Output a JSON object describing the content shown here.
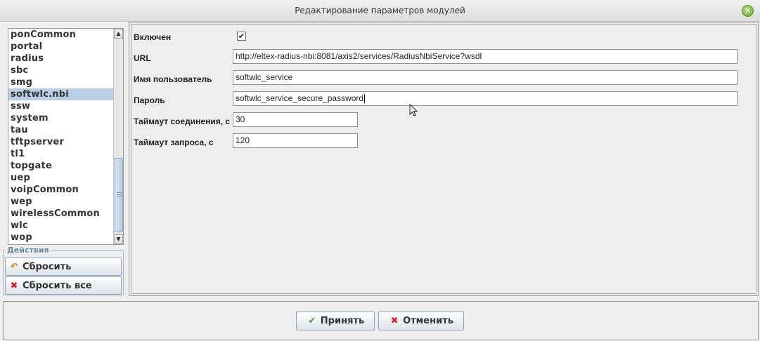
{
  "window": {
    "title": "Редактирование параметров модулей"
  },
  "modules": {
    "items": [
      "ponCommon",
      "portal",
      "radius",
      "sbc",
      "smg",
      "softwlc.nbi",
      "ssw",
      "system",
      "tau",
      "tftpserver",
      "tl1",
      "topgate",
      "uep",
      "voipCommon",
      "wep",
      "wirelessCommon",
      "wlc",
      "wop"
    ],
    "selected": "softwlc.nbi",
    "selection_color": "#b8cfe5"
  },
  "actions": {
    "legend": "Действия",
    "reset_label": "Сбросить",
    "reset_all_label": "Сбросить все"
  },
  "params": {
    "enabled": {
      "label": "Включен",
      "checked": true,
      "mark": "✔"
    },
    "url": {
      "label": "URL",
      "value": "http://eltex-radius-nbi:8081/axis2/services/RadiusNbiService?wsdl"
    },
    "username": {
      "label": "Имя пользователь",
      "value": "softwlc_service"
    },
    "password": {
      "label": "Пароль",
      "value": "softwlc_service_secure_password"
    },
    "connect_timeout": {
      "label": "Таймаут соединения, с",
      "value": "30"
    },
    "request_timeout": {
      "label": "Таймаут запроса, с",
      "value": "120"
    }
  },
  "footer": {
    "accept_label": "Принять",
    "cancel_label": "Отменить"
  },
  "colors": {
    "close_button": "#7bbf45",
    "group_border": "#a3b5c9",
    "reset_icon": "#c98a1a",
    "delete_icon": "#d8232a",
    "accept_icon": "#3c9a2e"
  },
  "icons": {
    "close": "close-icon",
    "reset": "undo-icon",
    "reset_all": "x-icon",
    "accept": "check-icon",
    "cancel": "x-icon"
  }
}
